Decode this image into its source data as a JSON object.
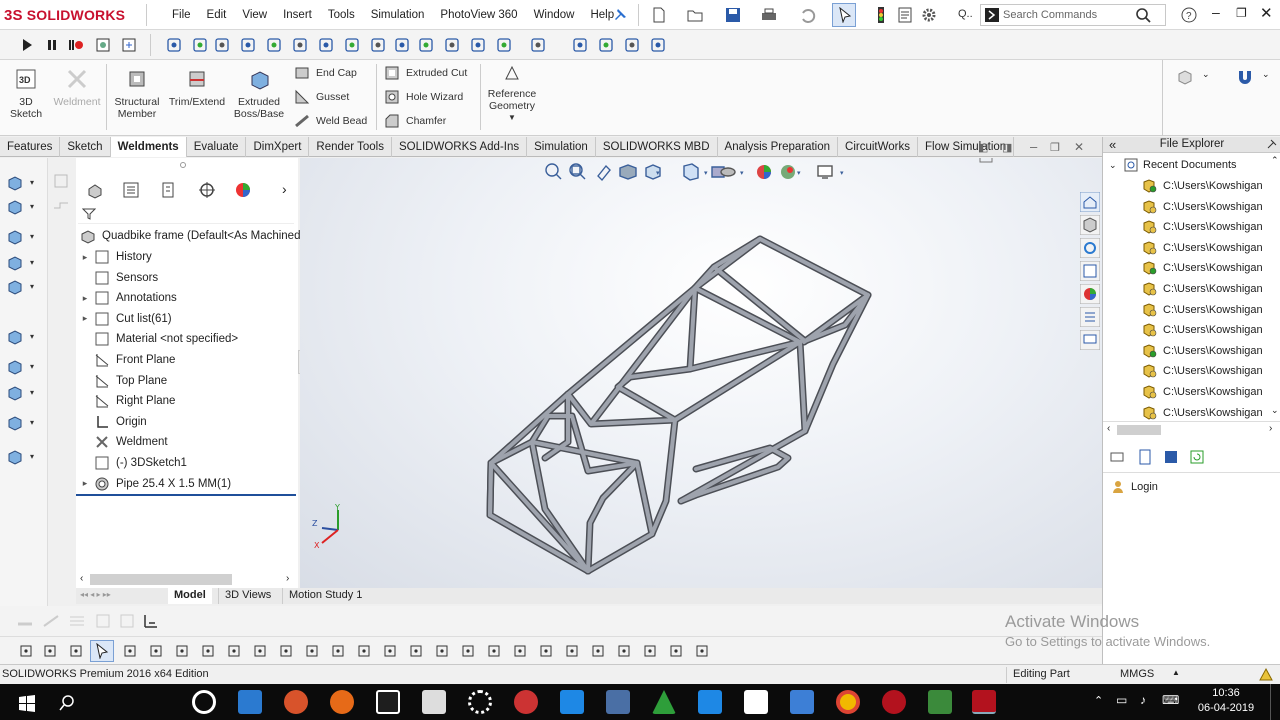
{
  "app": {
    "brand_prefix": "3S",
    "brand_name": "SOLIDWORKS"
  },
  "menu": [
    "File",
    "Edit",
    "View",
    "Insert",
    "Tools",
    "Simulation",
    "PhotoView 360",
    "Window",
    "Help"
  ],
  "search": {
    "placeholder": "Search Commands"
  },
  "command_manager": {
    "big": [
      {
        "label": "3D\nSketch",
        "icon": "3d-sketch-icon",
        "enabled": true
      },
      {
        "label": "Weldment",
        "icon": "weldment-icon",
        "enabled": false
      },
      {
        "label": "Structural\nMember",
        "icon": "structural-member-icon",
        "enabled": true
      },
      {
        "label": "Trim/Extend",
        "icon": "trim-extend-icon",
        "enabled": true
      },
      {
        "label": "Extruded\nBoss/Base",
        "icon": "extruded-boss-icon",
        "enabled": true
      }
    ],
    "small_col1": [
      "End Cap",
      "Gusset",
      "Weld Bead"
    ],
    "small_col2": [
      "Extruded Cut",
      "Hole Wizard",
      "Chamfer"
    ],
    "reference": "Reference\nGeometry"
  },
  "tabs": [
    {
      "label": "Features",
      "active": false
    },
    {
      "label": "Sketch",
      "active": false
    },
    {
      "label": "Weldments",
      "active": true
    },
    {
      "label": "Evaluate",
      "active": false
    },
    {
      "label": "DimXpert",
      "active": false
    },
    {
      "label": "Render Tools",
      "active": false
    },
    {
      "label": "SOLIDWORKS Add-Ins",
      "active": false
    },
    {
      "label": "Simulation",
      "active": false
    },
    {
      "label": "SOLIDWORKS MBD",
      "active": false
    },
    {
      "label": "Analysis Preparation",
      "active": false
    },
    {
      "label": "CircuitWorks",
      "active": false
    },
    {
      "label": "Flow Simulation",
      "active": false
    }
  ],
  "tree": {
    "root": "Quadbike frame  (Default<As Machined",
    "items": [
      {
        "label": "History",
        "expandable": true,
        "icon": "history-icon"
      },
      {
        "label": "Sensors",
        "expandable": false,
        "icon": "sensors-icon"
      },
      {
        "label": "Annotations",
        "expandable": true,
        "icon": "annotations-icon"
      },
      {
        "label": "Cut list(61)",
        "expandable": true,
        "icon": "cut-list-icon"
      },
      {
        "label": "Material <not specified>",
        "expandable": false,
        "icon": "material-icon"
      },
      {
        "label": "Front Plane",
        "expandable": false,
        "icon": "plane-icon"
      },
      {
        "label": "Top Plane",
        "expandable": false,
        "icon": "plane-icon"
      },
      {
        "label": "Right Plane",
        "expandable": false,
        "icon": "plane-icon"
      },
      {
        "label": "Origin",
        "expandable": false,
        "icon": "origin-icon"
      },
      {
        "label": "Weldment",
        "expandable": false,
        "icon": "weldment-icon"
      },
      {
        "label": "(-) 3DSketch1",
        "expandable": false,
        "icon": "sketch-icon"
      },
      {
        "label": "Pipe 25.4 X 1.5 MM(1)",
        "expandable": true,
        "icon": "pipe-icon"
      }
    ]
  },
  "file_explorer": {
    "title": "File Explorer",
    "recent": "Recent Documents",
    "docs": [
      "C:\\Users\\Kowshigan",
      "C:\\Users\\Kowshigan",
      "C:\\Users\\Kowshigan",
      "C:\\Users\\Kowshigan",
      "C:\\Users\\Kowshigan",
      "C:\\Users\\Kowshigan",
      "C:\\Users\\Kowshigan",
      "C:\\Users\\Kowshigan",
      "C:\\Users\\Kowshigan",
      "C:\\Users\\Kowshigan",
      "C:\\Users\\Kowshigan",
      "C:\\Users\\Kowshigan"
    ],
    "login": "Login"
  },
  "bottom_tabs": [
    "Model",
    "3D Views",
    "Motion Study 1"
  ],
  "watermark": {
    "line1": "Activate Windows",
    "line2": "Go to Settings to activate Windows."
  },
  "status": {
    "left": "SOLIDWORKS Premium 2016 x64 Edition",
    "mode": "Editing Part",
    "units": "MMGS"
  },
  "clock": {
    "time": "10:36",
    "date": "06-04-2019"
  },
  "colors": {
    "accent": "#c8102e",
    "frame": "#8f939c"
  }
}
